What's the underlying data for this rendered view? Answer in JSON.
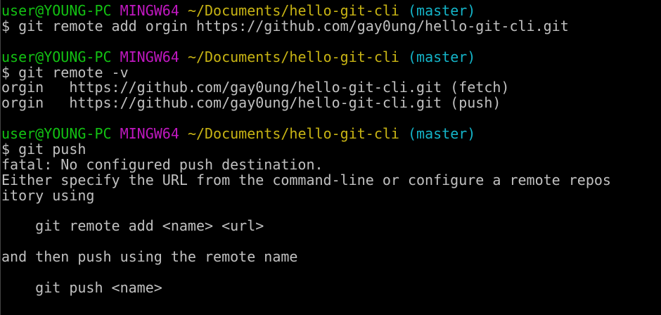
{
  "colors": {
    "background": "#000000",
    "text": "#c0c0c0",
    "user": "#13c213",
    "system": "#c018c0",
    "path": "#c8b414",
    "branch": "#14b4c8"
  },
  "prompt": {
    "user": "user@YOUNG-PC",
    "system": "MINGW64",
    "path": "~/Documents/hello-git-cli",
    "branch": "(master)"
  },
  "blocks": [
    {
      "command": "$ git remote add orgin https://github.com/gay0ung/hello-git-cli.git",
      "output": []
    },
    {
      "command": "$ git remote -v",
      "output": [
        "orgin   https://github.com/gay0ung/hello-git-cli.git (fetch)",
        "orgin   https://github.com/gay0ung/hello-git-cli.git (push)"
      ]
    },
    {
      "command": "$ git push",
      "output": [
        "fatal: No configured push destination.",
        "Either specify the URL from the command-line or configure a remote repos",
        "itory using",
        "",
        "    git remote add <name> <url>",
        "",
        "and then push using the remote name",
        "",
        "    git push <name>"
      ]
    }
  ]
}
